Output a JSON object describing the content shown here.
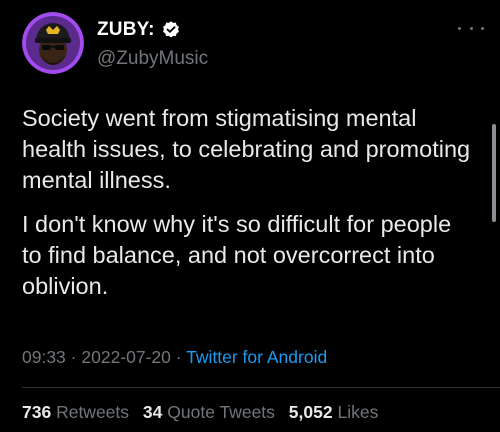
{
  "author": {
    "display_name": "ZUBY:",
    "handle": "@ZubyMusic",
    "verified": true,
    "avatar_ring_color": "#a24cf0",
    "verified_badge_color": "#ffffff"
  },
  "tweet": {
    "paragraphs": [
      "Society went from stigmatising mental health issues, to celebrating and promoting mental illness.",
      "I don't know why it's so difficult for people to find balance, and not overcorrect into oblivion."
    ]
  },
  "meta": {
    "time": "09:33",
    "separator": "·",
    "date": "2022-07-20",
    "source": "Twitter for Android"
  },
  "stats": [
    {
      "count": "736",
      "label": "Retweets"
    },
    {
      "count": "34",
      "label": "Quote Tweets"
    },
    {
      "count": "5,052",
      "label": "Likes"
    }
  ],
  "colors": {
    "background": "#000000",
    "text": "#e7e9ea",
    "muted": "#71767b",
    "link": "#1d9bf0",
    "divider": "#2f3336"
  },
  "icons": {
    "verified": "verified-badge-icon",
    "more": "more-options-icon"
  }
}
